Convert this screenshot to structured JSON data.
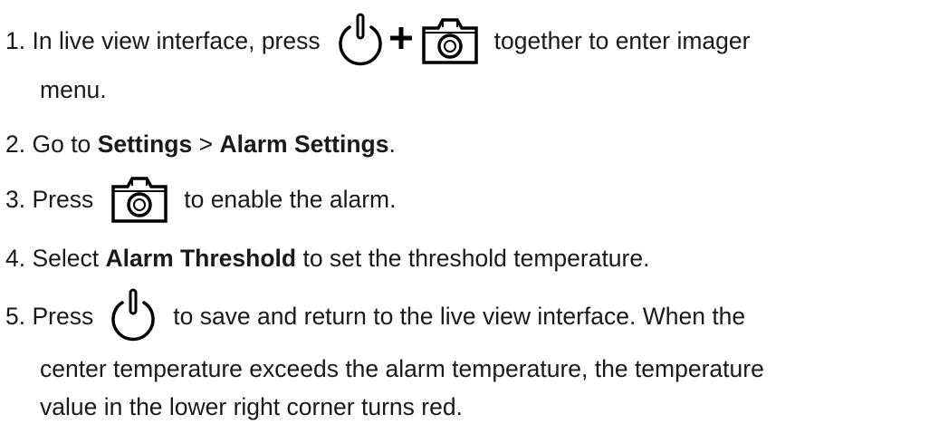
{
  "steps": [
    {
      "number": "1.",
      "text_before": "In live view interface, press",
      "plus": "+",
      "text_after": "together to enter imager",
      "continuation": "menu.",
      "icons": [
        "power-button-icon",
        "capture-button-icon"
      ]
    },
    {
      "number": "2.",
      "text_before": "Go to",
      "bold_1": "Settings",
      "separator": ">",
      "bold_2": "Alarm Settings",
      "text_after": "."
    },
    {
      "number": "3.",
      "text_before": "Press",
      "text_after": "to enable the alarm.",
      "icons": [
        "capture-button-icon"
      ]
    },
    {
      "number": "4.",
      "text_before": "Select",
      "bold_1": "Alarm Threshold",
      "text_after": "to set the threshold temperature."
    },
    {
      "number": "5.",
      "text_before": "Press",
      "text_after": "to save and return to the live view interface. When the",
      "continuation_1": "center temperature exceeds the alarm temperature, the temperature",
      "continuation_2": "value in the lower right corner turns red.",
      "icons": [
        "power-button-icon"
      ]
    }
  ]
}
